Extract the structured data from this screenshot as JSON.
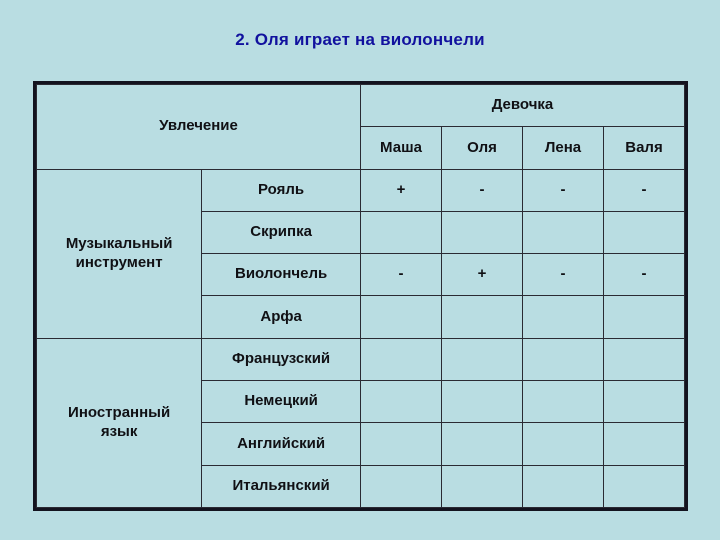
{
  "title": "2. Оля играет на виолончели",
  "title_color": "#11119e",
  "background_color": "#b9dde2",
  "plus_color": "#1111e0",
  "minus_color": "#101014",
  "table": {
    "hobby_header": "Увлечение",
    "girl_header": "Девочка",
    "names": [
      "Маша",
      "Оля",
      "Лена",
      "Валя"
    ],
    "groups": [
      {
        "label": "Музыкальный инструмент",
        "label_line1": "Музыкальный",
        "label_line2": "инструмент",
        "rows": [
          {
            "label": "Рояль",
            "marks": [
              "+",
              "-",
              "-",
              "-"
            ]
          },
          {
            "label": "Скрипка",
            "marks": [
              "",
              "",
              "",
              ""
            ]
          },
          {
            "label": "Виолончель",
            "marks": [
              "-",
              "+",
              "-",
              "-"
            ]
          },
          {
            "label": "Арфа",
            "marks": [
              "",
              "",
              "",
              ""
            ]
          }
        ]
      },
      {
        "label": "Иностранный язык",
        "label_line1": "Иностранный",
        "label_line2": "язык",
        "rows": [
          {
            "label": "Французский",
            "marks": [
              "",
              "",
              "",
              ""
            ]
          },
          {
            "label": "Немецкий",
            "marks": [
              "",
              "",
              "",
              ""
            ]
          },
          {
            "label": "Английский",
            "marks": [
              "",
              "",
              "",
              ""
            ]
          },
          {
            "label": "Итальянский",
            "marks": [
              "",
              "",
              "",
              ""
            ]
          }
        ]
      }
    ]
  }
}
